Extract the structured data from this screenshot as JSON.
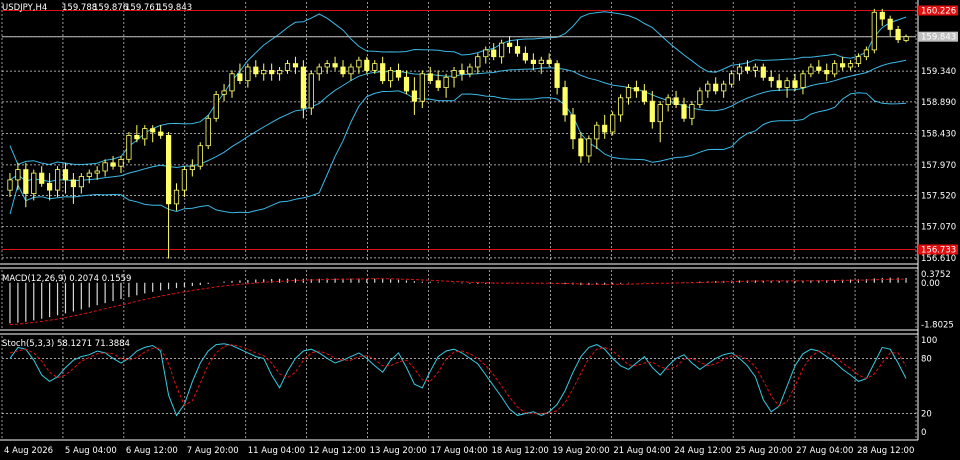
{
  "chart_data": [
    {
      "type": "candlestick",
      "title": "USDJPY,H4",
      "ohlc_readout": [
        "159.788",
        "159.876",
        "159.761",
        "159.843"
      ],
      "ylim": [
        156.55,
        160.35
      ],
      "y_ticks": [
        "159.843",
        "159.340",
        "158.890",
        "158.430",
        "157.970",
        "157.520",
        "157.070",
        "156.610"
      ],
      "level_lines": [
        {
          "value": 160.226,
          "label": "160.226",
          "color": "#e01010"
        },
        {
          "value": 156.733,
          "label": "156.733",
          "color": "#e01010"
        },
        {
          "value": 159.843,
          "label": "159.843",
          "color": "#c0c0c0"
        }
      ],
      "x_tick_labels": [
        "4 Aug 2026",
        "5 Aug 04:00",
        "6 Aug 12:00",
        "7 Aug 20:00",
        "11 Aug 04:00",
        "12 Aug 12:00",
        "13 Aug 20:00",
        "17 Aug 04:00",
        "18 Aug 12:00",
        "19 Aug 20:00",
        "21 Aug 04:00",
        "24 Aug 12:00",
        "25 Aug 20:00",
        "27 Aug 04:00",
        "28 Aug 12:00"
      ],
      "candles": [
        [
          157.6,
          157.85,
          157.5,
          157.75
        ],
        [
          157.75,
          158.0,
          157.6,
          157.9
        ],
        [
          157.9,
          158.0,
          157.35,
          157.55
        ],
        [
          157.55,
          157.9,
          157.45,
          157.85
        ],
        [
          157.85,
          157.95,
          157.65,
          157.7
        ],
        [
          157.7,
          157.85,
          157.45,
          157.6
        ],
        [
          157.6,
          157.95,
          157.5,
          157.9
        ],
        [
          157.9,
          158.0,
          157.55,
          157.75
        ],
        [
          157.75,
          157.85,
          157.4,
          157.65
        ],
        [
          157.65,
          157.85,
          157.55,
          157.8
        ],
        [
          157.8,
          157.9,
          157.7,
          157.85
        ],
        [
          157.85,
          157.95,
          157.75,
          157.88
        ],
        [
          157.88,
          158.05,
          157.8,
          158.0
        ],
        [
          158.0,
          158.1,
          157.9,
          157.95
        ],
        [
          157.95,
          158.1,
          157.85,
          158.05
        ],
        [
          158.05,
          158.45,
          158.0,
          158.4
        ],
        [
          158.4,
          158.55,
          158.3,
          158.35
        ],
        [
          158.35,
          158.55,
          158.25,
          158.5
        ],
        [
          158.5,
          158.55,
          158.3,
          158.45
        ],
        [
          158.45,
          158.55,
          158.35,
          158.4
        ],
        [
          158.4,
          158.45,
          156.6,
          157.4
        ],
        [
          157.4,
          157.7,
          157.3,
          157.6
        ],
        [
          157.6,
          157.95,
          157.5,
          157.9
        ],
        [
          157.9,
          158.05,
          157.8,
          157.95
        ],
        [
          157.95,
          158.3,
          157.9,
          158.25
        ],
        [
          158.25,
          158.7,
          158.2,
          158.65
        ],
        [
          158.65,
          159.05,
          158.6,
          159.0
        ],
        [
          159.0,
          159.15,
          158.9,
          159.05
        ],
        [
          159.05,
          159.35,
          158.95,
          159.3
        ],
        [
          159.3,
          159.45,
          159.15,
          159.2
        ],
        [
          159.2,
          159.45,
          159.1,
          159.4
        ],
        [
          159.4,
          159.5,
          159.25,
          159.3
        ],
        [
          159.3,
          159.45,
          159.2,
          159.35
        ],
        [
          159.35,
          159.45,
          159.2,
          159.3
        ],
        [
          159.3,
          159.4,
          159.2,
          159.35
        ],
        [
          159.35,
          159.5,
          159.3,
          159.45
        ],
        [
          159.45,
          159.55,
          159.3,
          159.4
        ],
        [
          159.4,
          159.5,
          158.65,
          158.8
        ],
        [
          158.8,
          159.35,
          158.7,
          159.3
        ],
        [
          159.3,
          159.45,
          159.2,
          159.4
        ],
        [
          159.4,
          159.5,
          159.3,
          159.45
        ],
        [
          159.45,
          159.55,
          159.35,
          159.4
        ],
        [
          159.4,
          159.5,
          159.25,
          159.3
        ],
        [
          159.3,
          159.45,
          159.2,
          159.4
        ],
        [
          159.4,
          159.55,
          159.3,
          159.5
        ],
        [
          159.5,
          159.55,
          159.3,
          159.35
        ],
        [
          159.35,
          159.5,
          159.3,
          159.45
        ],
        [
          159.45,
          159.55,
          159.15,
          159.2
        ],
        [
          159.2,
          159.4,
          159.1,
          159.35
        ],
        [
          159.35,
          159.45,
          159.2,
          159.25
        ],
        [
          159.25,
          159.35,
          159.0,
          159.05
        ],
        [
          159.05,
          159.25,
          158.7,
          158.9
        ],
        [
          158.9,
          159.35,
          158.8,
          159.3
        ],
        [
          159.3,
          159.4,
          159.15,
          159.2
        ],
        [
          159.2,
          159.35,
          159.05,
          159.1
        ],
        [
          159.1,
          159.3,
          158.95,
          159.25
        ],
        [
          159.25,
          159.4,
          159.1,
          159.35
        ],
        [
          159.35,
          159.45,
          159.2,
          159.3
        ],
        [
          159.3,
          159.45,
          159.25,
          159.4
        ],
        [
          159.4,
          159.6,
          159.3,
          159.55
        ],
        [
          159.55,
          159.7,
          159.45,
          159.65
        ],
        [
          159.65,
          159.75,
          159.5,
          159.55
        ],
        [
          159.55,
          159.8,
          159.45,
          159.75
        ],
        [
          159.75,
          159.85,
          159.6,
          159.7
        ],
        [
          159.7,
          159.8,
          159.55,
          159.6
        ],
        [
          159.6,
          159.7,
          159.45,
          159.5
        ],
        [
          159.5,
          159.6,
          159.35,
          159.45
        ],
        [
          159.45,
          159.55,
          159.3,
          159.5
        ],
        [
          159.5,
          159.6,
          159.4,
          159.45
        ],
        [
          159.45,
          159.5,
          159.0,
          159.1
        ],
        [
          159.1,
          159.2,
          158.6,
          158.7
        ],
        [
          158.7,
          158.8,
          158.2,
          158.35
        ],
        [
          158.35,
          158.45,
          158.0,
          158.1
        ],
        [
          158.1,
          158.4,
          158.0,
          158.35
        ],
        [
          158.35,
          158.6,
          158.2,
          158.55
        ],
        [
          158.55,
          158.7,
          158.35,
          158.45
        ],
        [
          158.45,
          158.75,
          158.4,
          158.7
        ],
        [
          158.7,
          159.0,
          158.6,
          158.95
        ],
        [
          158.95,
          159.15,
          158.85,
          159.1
        ],
        [
          159.1,
          159.2,
          158.95,
          159.05
        ],
        [
          159.05,
          159.15,
          158.85,
          158.9
        ],
        [
          158.9,
          159.05,
          158.5,
          158.6
        ],
        [
          158.6,
          158.9,
          158.3,
          158.85
        ],
        [
          158.85,
          159.0,
          158.75,
          158.95
        ],
        [
          158.95,
          159.05,
          158.8,
          158.85
        ],
        [
          158.85,
          158.95,
          158.6,
          158.65
        ],
        [
          158.65,
          158.9,
          158.55,
          158.85
        ],
        [
          158.85,
          159.1,
          158.8,
          159.05
        ],
        [
          159.05,
          159.2,
          158.95,
          159.15
        ],
        [
          159.15,
          159.25,
          159.0,
          159.05
        ],
        [
          159.05,
          159.2,
          158.95,
          159.15
        ],
        [
          159.15,
          159.35,
          159.1,
          159.3
        ],
        [
          159.3,
          159.45,
          159.2,
          159.4
        ],
        [
          159.4,
          159.5,
          159.3,
          159.35
        ],
        [
          159.35,
          159.45,
          159.25,
          159.4
        ],
        [
          159.4,
          159.45,
          159.2,
          159.25
        ],
        [
          159.25,
          159.35,
          159.1,
          159.2
        ],
        [
          159.2,
          159.3,
          159.05,
          159.1
        ],
        [
          159.1,
          159.25,
          158.95,
          159.2
        ],
        [
          159.2,
          159.3,
          159.05,
          159.1
        ],
        [
          159.1,
          159.35,
          159.0,
          159.3
        ],
        [
          159.3,
          159.45,
          159.25,
          159.4
        ],
        [
          159.4,
          159.5,
          159.3,
          159.35
        ],
        [
          159.35,
          159.45,
          159.2,
          159.3
        ],
        [
          159.3,
          159.5,
          159.25,
          159.45
        ],
        [
          159.45,
          159.55,
          159.35,
          159.4
        ],
        [
          159.4,
          159.5,
          159.35,
          159.45
        ],
        [
          159.45,
          159.6,
          159.4,
          159.55
        ],
        [
          159.55,
          159.7,
          159.5,
          159.65
        ],
        [
          159.65,
          160.25,
          159.6,
          160.2
        ],
        [
          160.2,
          160.25,
          160.0,
          160.1
        ],
        [
          160.1,
          160.15,
          159.85,
          159.95
        ],
        [
          159.95,
          160.0,
          159.75,
          159.8
        ],
        [
          159.788,
          159.876,
          159.761,
          159.843
        ]
      ]
    },
    {
      "type": "histogram",
      "title": "MACD(12,26,9) 0.2074 0.1559",
      "y_ticks": [
        "0.3752",
        "0.00",
        "-1.8025"
      ],
      "ylim": [
        -1.95,
        0.55
      ],
      "macd_values": [
        -1.75,
        -1.72,
        -1.68,
        -1.62,
        -1.55,
        -1.48,
        -1.4,
        -1.32,
        -1.24,
        -1.15,
        -1.06,
        -0.97,
        -0.88,
        -0.79,
        -0.7,
        -0.62,
        -0.54,
        -0.46,
        -0.39,
        -0.33,
        -0.28,
        -0.23,
        -0.18,
        -0.14,
        -0.1,
        -0.05,
        0.0,
        0.05,
        0.08,
        0.1,
        0.12,
        0.14,
        0.15,
        0.16,
        0.17,
        0.18,
        0.18,
        0.17,
        0.16,
        0.17,
        0.18,
        0.18,
        0.18,
        0.18,
        0.18,
        0.18,
        0.18,
        0.17,
        0.15,
        0.13,
        0.1,
        0.07,
        0.05,
        0.04,
        0.02,
        0.0,
        -0.02,
        -0.03,
        -0.04,
        -0.05,
        -0.05,
        -0.04,
        -0.03,
        -0.02,
        -0.01,
        0.0,
        0.0,
        -0.01,
        -0.02,
        -0.04,
        -0.06,
        -0.08,
        -0.1,
        -0.1,
        -0.09,
        -0.08,
        -0.06,
        -0.04,
        -0.02,
        0.0,
        0.01,
        0.01,
        0.0,
        0.0,
        0.01,
        0.02,
        0.03,
        0.05,
        0.06,
        0.07,
        0.08,
        0.09,
        0.1,
        0.1,
        0.1,
        0.1,
        0.09,
        0.08,
        0.08,
        0.08,
        0.09,
        0.1,
        0.11,
        0.12,
        0.12,
        0.13,
        0.14,
        0.15,
        0.16,
        0.19,
        0.21,
        0.22,
        0.22,
        0.2074
      ],
      "signal_values": [
        -1.8,
        -1.78,
        -1.75,
        -1.71,
        -1.67,
        -1.62,
        -1.56,
        -1.5,
        -1.43,
        -1.36,
        -1.28,
        -1.2,
        -1.12,
        -1.04,
        -0.96,
        -0.88,
        -0.8,
        -0.72,
        -0.65,
        -0.58,
        -0.51,
        -0.45,
        -0.39,
        -0.33,
        -0.28,
        -0.23,
        -0.18,
        -0.14,
        -0.1,
        -0.07,
        -0.04,
        -0.01,
        0.02,
        0.04,
        0.06,
        0.08,
        0.1,
        0.11,
        0.12,
        0.13,
        0.14,
        0.15,
        0.15,
        0.16,
        0.16,
        0.17,
        0.17,
        0.17,
        0.17,
        0.16,
        0.15,
        0.14,
        0.12,
        0.11,
        0.09,
        0.07,
        0.05,
        0.04,
        0.02,
        0.01,
        0.0,
        -0.01,
        -0.02,
        -0.02,
        -0.02,
        -0.02,
        -0.02,
        -0.02,
        -0.02,
        -0.03,
        -0.03,
        -0.04,
        -0.05,
        -0.06,
        -0.06,
        -0.07,
        -0.07,
        -0.06,
        -0.06,
        -0.05,
        -0.04,
        -0.03,
        -0.02,
        -0.02,
        -0.01,
        0.0,
        0.0,
        0.01,
        0.02,
        0.03,
        0.04,
        0.05,
        0.06,
        0.07,
        0.07,
        0.08,
        0.08,
        0.08,
        0.08,
        0.08,
        0.08,
        0.09,
        0.09,
        0.09,
        0.1,
        0.1,
        0.11,
        0.11,
        0.12,
        0.13,
        0.14,
        0.15,
        0.15,
        0.1559
      ]
    },
    {
      "type": "line",
      "title": "Stoch(5,3,3) 58.1271 71.3884",
      "y_ticks": [
        "100",
        "80",
        "20",
        "0"
      ],
      "ylim": [
        0,
        100
      ],
      "k_values": [
        80,
        92,
        90,
        78,
        62,
        55,
        60,
        70,
        78,
        82,
        84,
        88,
        86,
        80,
        75,
        80,
        88,
        92,
        94,
        88,
        40,
        18,
        30,
        55,
        75,
        88,
        95,
        96,
        94,
        90,
        86,
        82,
        80,
        62,
        48,
        66,
        80,
        88,
        90,
        86,
        80,
        75,
        78,
        82,
        86,
        80,
        72,
        65,
        78,
        86,
        70,
        52,
        48,
        66,
        82,
        88,
        90,
        86,
        80,
        74,
        62,
        50,
        38,
        25,
        18,
        20,
        22,
        18,
        22,
        30,
        45,
        65,
        82,
        92,
        95,
        90,
        80,
        72,
        68,
        75,
        82,
        70,
        62,
        72,
        80,
        84,
        75,
        68,
        74,
        80,
        84,
        86,
        80,
        72,
        60,
        35,
        22,
        28,
        50,
        72,
        85,
        90,
        88,
        82,
        76,
        68,
        62,
        55,
        58,
        75,
        92,
        90,
        75,
        58.1271
      ],
      "d_values": [
        86,
        88,
        90,
        86,
        77,
        65,
        59,
        62,
        69,
        77,
        81,
        85,
        86,
        85,
        80,
        78,
        81,
        87,
        91,
        91,
        74,
        49,
        29,
        34,
        53,
        73,
        86,
        93,
        95,
        93,
        90,
        86,
        83,
        75,
        63,
        59,
        65,
        78,
        86,
        88,
        85,
        80,
        78,
        78,
        82,
        83,
        79,
        72,
        72,
        76,
        78,
        69,
        57,
        55,
        65,
        79,
        87,
        88,
        85,
        80,
        72,
        62,
        50,
        38,
        27,
        21,
        20,
        20,
        21,
        23,
        32,
        47,
        64,
        80,
        90,
        92,
        88,
        81,
        73,
        72,
        75,
        76,
        71,
        68,
        71,
        79,
        80,
        76,
        72,
        74,
        79,
        83,
        83,
        79,
        71,
        56,
        39,
        28,
        33,
        50,
        69,
        82,
        88,
        87,
        82,
        75,
        69,
        62,
        58,
        63,
        75,
        86,
        86,
        71.3884
      ]
    }
  ],
  "colors": {
    "background": "#000000",
    "grid": "#ffffff",
    "candle_up": "#ffff66",
    "candle_down": "#ffff66",
    "bollinger": "#3bb8e6",
    "level_line": "#e01010",
    "current_line": "#c0c0c0",
    "macd_hist": "#d8d8d8",
    "macd_signal": "#e01010",
    "stoch_k": "#37c9e0",
    "stoch_d": "#e01010",
    "axis_text": "#ffffff"
  }
}
